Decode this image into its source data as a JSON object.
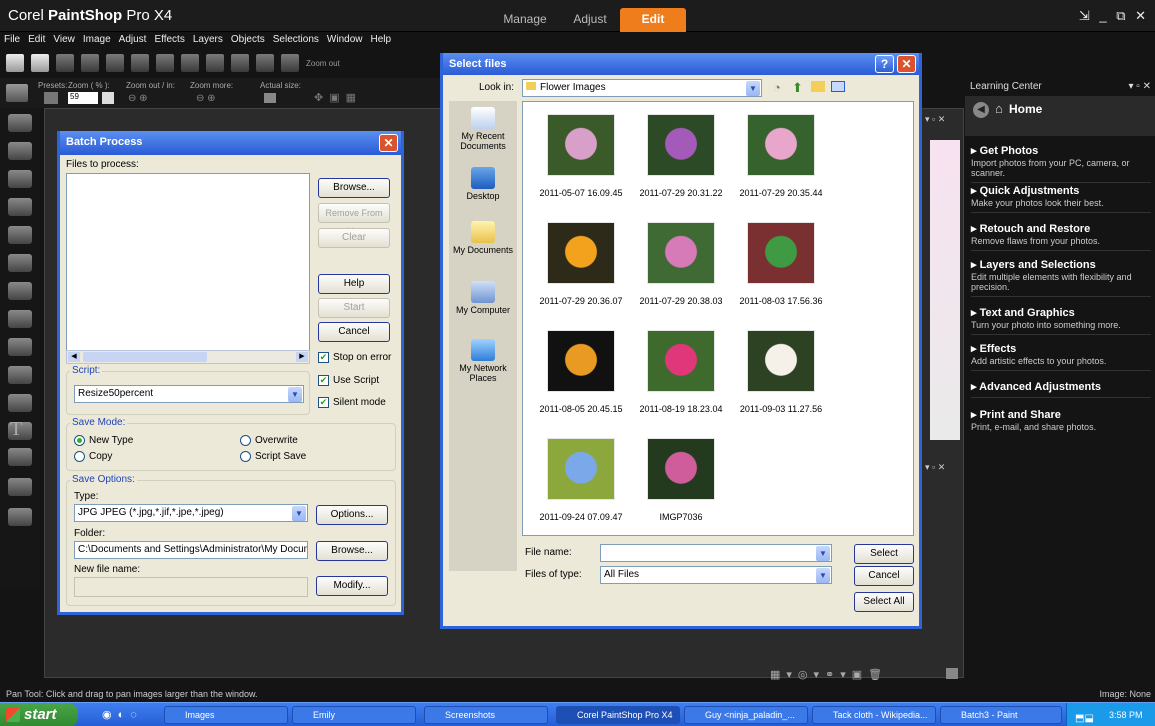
{
  "app": {
    "title_prefix": "Corel ",
    "title_brand": "PaintShop",
    "title_suffix": " Pro X4",
    "window_controls": "⇲ _ ⧉ ✕"
  },
  "workspace_tabs": [
    {
      "label": "Manage"
    },
    {
      "label": "Adjust"
    },
    {
      "label": "Edit"
    }
  ],
  "menu": [
    "File",
    "Edit",
    "View",
    "Image",
    "Adjust",
    "Effects",
    "Layers",
    "Objects",
    "Selections",
    "Window",
    "Help"
  ],
  "toolbar": {
    "zoom_out_label": "Zoom out"
  },
  "presets_bar": {
    "presets": "Presets:",
    "zoom": "Zoom ( % ):",
    "zoom_value": "59",
    "zoom_inout": "Zoom out / in:",
    "zoom_more": "Zoom more:",
    "actual": "Actual size:"
  },
  "batch": {
    "title": "Batch Process",
    "files_label": "Files to process:",
    "buttons": {
      "browse": "Browse...",
      "remove": "Remove From List",
      "clear": "Clear",
      "help": "Help",
      "start": "Start",
      "cancel": "Cancel",
      "options": "Options...",
      "browse2": "Browse...",
      "modify": "Modify..."
    },
    "stop_on_error": "Stop on error",
    "script_label": "Script:",
    "script_value": "Resize50percent",
    "use_script": "Use Script",
    "silent_mode": "Silent mode",
    "save_mode_label": "Save Mode:",
    "modes": {
      "new_type": "New Type",
      "overwrite": "Overwrite",
      "copy": "Copy",
      "script_save": "Script Save"
    },
    "save_options_label": "Save Options:",
    "type_label": "Type:",
    "type_value": "JPG JPEG  (*.jpg,*.jif,*.jpe,*.jpeg)",
    "folder_label": "Folder:",
    "folder_value": "C:\\Documents and Settings\\Administrator\\My Documents\\M",
    "new_file_label": "New file name:"
  },
  "select_files": {
    "title": "Select files",
    "help_glyph": "?",
    "look_in_label": "Look in:",
    "look_in_value": "Flower Images",
    "places": [
      "My Recent Documents",
      "Desktop",
      "My Documents",
      "My Computer",
      "My Network Places"
    ],
    "files": [
      {
        "name": "2011-05-07 16.09.45",
        "colors": [
          "#3a5a2a",
          "#d8a0c8"
        ]
      },
      {
        "name": "2011-07-29 20.31.22",
        "colors": [
          "#2c4a26",
          "#a35ab8"
        ]
      },
      {
        "name": "2011-07-29 20.35.44",
        "colors": [
          "#36622e",
          "#e8a6cc"
        ]
      },
      {
        "name": "2011-07-29 20.36.07",
        "colors": [
          "#2d2a1a",
          "#f2a21c"
        ]
      },
      {
        "name": "2011-07-29 20.38.03",
        "colors": [
          "#3f6a33",
          "#d77ab8"
        ]
      },
      {
        "name": "2011-08-03 17.56.36",
        "colors": [
          "#7a3030",
          "#3f9a44"
        ]
      },
      {
        "name": "2011-08-05 20.45.15",
        "colors": [
          "#111111",
          "#e89a22"
        ]
      },
      {
        "name": "2011-08-19 18.23.04",
        "colors": [
          "#3e6a2e",
          "#e0367a"
        ]
      },
      {
        "name": "2011-09-03 11.27.56",
        "colors": [
          "#2c4222",
          "#f5f0e8"
        ]
      },
      {
        "name": "2011-09-24 07.09.47",
        "colors": [
          "#8ca83c",
          "#7aa8e8"
        ]
      },
      {
        "name": "IMGP7036",
        "colors": [
          "#233a1e",
          "#cf5d9c"
        ]
      }
    ],
    "file_name_label": "File name:",
    "file_name_value": "",
    "files_of_type_label": "Files of type:",
    "files_of_type_value": "All Files",
    "select": "Select",
    "cancel": "Cancel",
    "select_all": "Select All"
  },
  "learning_center": {
    "title": "Learning Center",
    "home": "Home",
    "items": [
      {
        "title": "Get Photos",
        "desc": "Import photos from your PC, camera, or scanner."
      },
      {
        "title": "Quick Adjustments",
        "desc": "Make your photos look their best."
      },
      {
        "title": "Retouch and Restore",
        "desc": "Remove flaws from your photos."
      },
      {
        "title": "Layers and Selections",
        "desc": "Edit multiple elements with flexibility and precision."
      },
      {
        "title": "Text and Graphics",
        "desc": "Turn your photo into something more."
      },
      {
        "title": "Effects",
        "desc": "Add artistic effects to your photos."
      },
      {
        "title": "Advanced Adjustments",
        "desc": ""
      },
      {
        "title": "Print and Share",
        "desc": "Print, e-mail, and share photos."
      }
    ]
  },
  "status": {
    "left": "Pan Tool: Click and drag to pan images larger than the window.",
    "right": "Image: None"
  },
  "taskbar": {
    "start": "start",
    "items": [
      "Images",
      "Emily",
      "Screenshots",
      "Corel PaintShop Pro X4",
      "Guy <ninja_paladin_...",
      "Tack cloth - Wikipedia...",
      "Batch3 - Paint"
    ],
    "clock": "3:58 PM"
  },
  "colors": {
    "accent_tab": "#f07d1c",
    "xp_blue": "#2a5bd6",
    "dialog_bg": "#ece9d8"
  }
}
